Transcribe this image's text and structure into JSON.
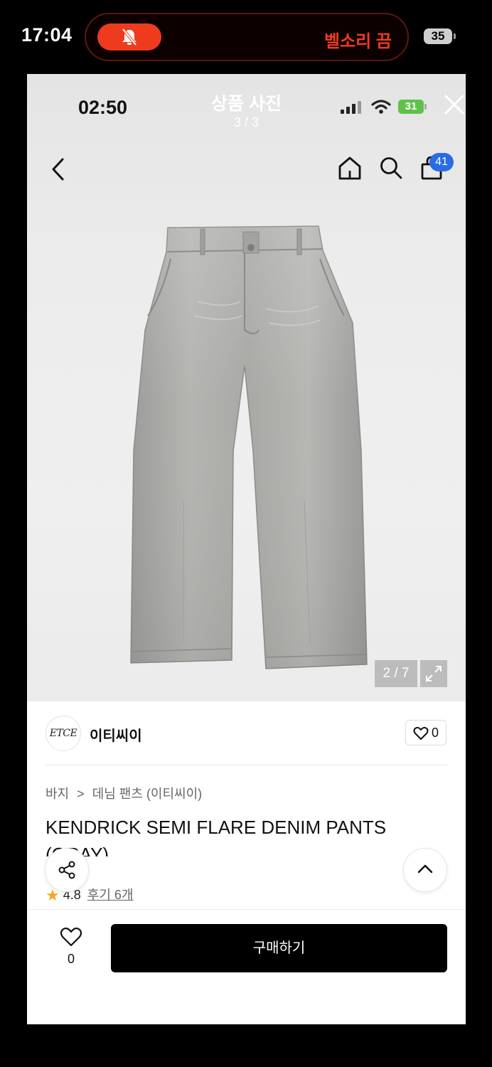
{
  "outer_status": {
    "time": "17:04",
    "silent_mode_label": "벨소리 끔",
    "battery": "35"
  },
  "viewer": {
    "title": "상품 사진",
    "counter": "3 / 3",
    "inner_time": "02:50",
    "inner_battery": "31"
  },
  "header": {
    "cart_count": "41"
  },
  "image": {
    "counter": "2 / 7"
  },
  "brand": {
    "logo_text": "ETCE",
    "name": "이티씨이",
    "like_count": "0"
  },
  "product": {
    "breadcrumb_category": "바지",
    "breadcrumb_separator": ">",
    "breadcrumb_sub": "데님 팬츠 (이티씨이)",
    "title": "KENDRICK SEMI FLARE DENIM PANTS (GRAY)",
    "rating": "4.8",
    "review_label": "후기 6개"
  },
  "bottom_bar": {
    "like_count": "0",
    "buy_label": "구매하기"
  }
}
